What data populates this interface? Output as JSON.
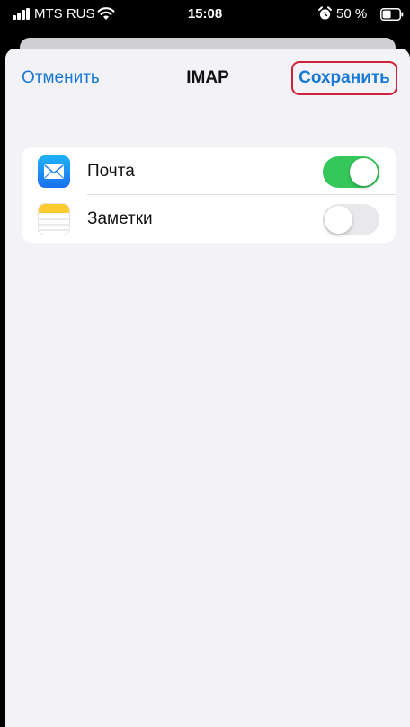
{
  "status_bar": {
    "carrier": "MTS RUS",
    "time": "15:08",
    "battery_percent": "50 %",
    "icons": [
      "signal-icon",
      "wifi-icon",
      "alarm-icon",
      "battery-icon"
    ]
  },
  "nav": {
    "cancel_label": "Отменить",
    "title": "IMAP",
    "save_label": "Сохранить"
  },
  "services": [
    {
      "label": "Почта",
      "icon": "mail-icon",
      "enabled": true
    },
    {
      "label": "Заметки",
      "icon": "notes-icon",
      "enabled": false
    }
  ],
  "colors": {
    "accent": "#1778d6",
    "toggle_on": "#36c75b",
    "toggle_off": "#e9e9eb",
    "highlight": "#d0213a",
    "sheet_background": "#f2f2f7"
  }
}
